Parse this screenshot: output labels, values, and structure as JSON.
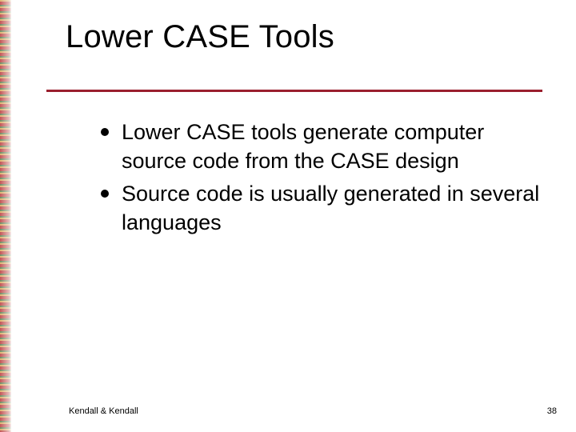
{
  "title": "Lower CASE Tools",
  "bullets": [
    "Lower CASE tools generate computer source code from the CASE design",
    "Source code is usually generated in several languages"
  ],
  "footer": {
    "left": "Kendall & Kendall",
    "right": "38"
  },
  "colors": {
    "rule": "#9a1f2e"
  }
}
